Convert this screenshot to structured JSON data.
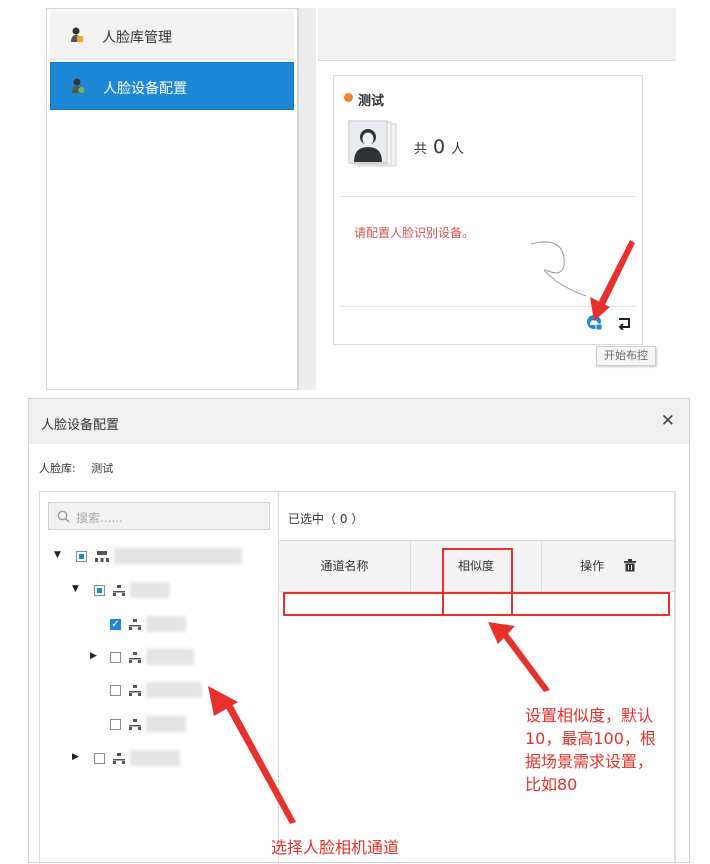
{
  "sidebar": {
    "items": [
      {
        "label": "人脸库管理",
        "active": false,
        "icon": "face-library-icon"
      },
      {
        "label": "人脸设备配置",
        "active": true,
        "icon": "face-device-icon"
      }
    ]
  },
  "card": {
    "title": "测试",
    "count_prefix": "共",
    "count_value": "0",
    "count_suffix": "人",
    "warning": "请配置人脸识别设备。",
    "tooltip": "开始布控"
  },
  "dialog": {
    "title": "人脸设备配置",
    "library_label": "人脸库:",
    "library_value": "测试",
    "search_placeholder": "搜索......",
    "selected_text": "已选中（ 0 ）",
    "columns": [
      "通道名称",
      "相似度",
      "操作"
    ]
  },
  "annotations": {
    "similarity_note_lines": [
      "设置相似度，默认",
      "10，最高100，根",
      "据场景需求设置，",
      "比如80"
    ],
    "channel_note": "选择人脸相机通道"
  },
  "colors": {
    "accent_blue": "#1e88d6",
    "annotation_red": "#e8302c",
    "warning_red": "#d9534f",
    "status_orange": "#f08030"
  }
}
